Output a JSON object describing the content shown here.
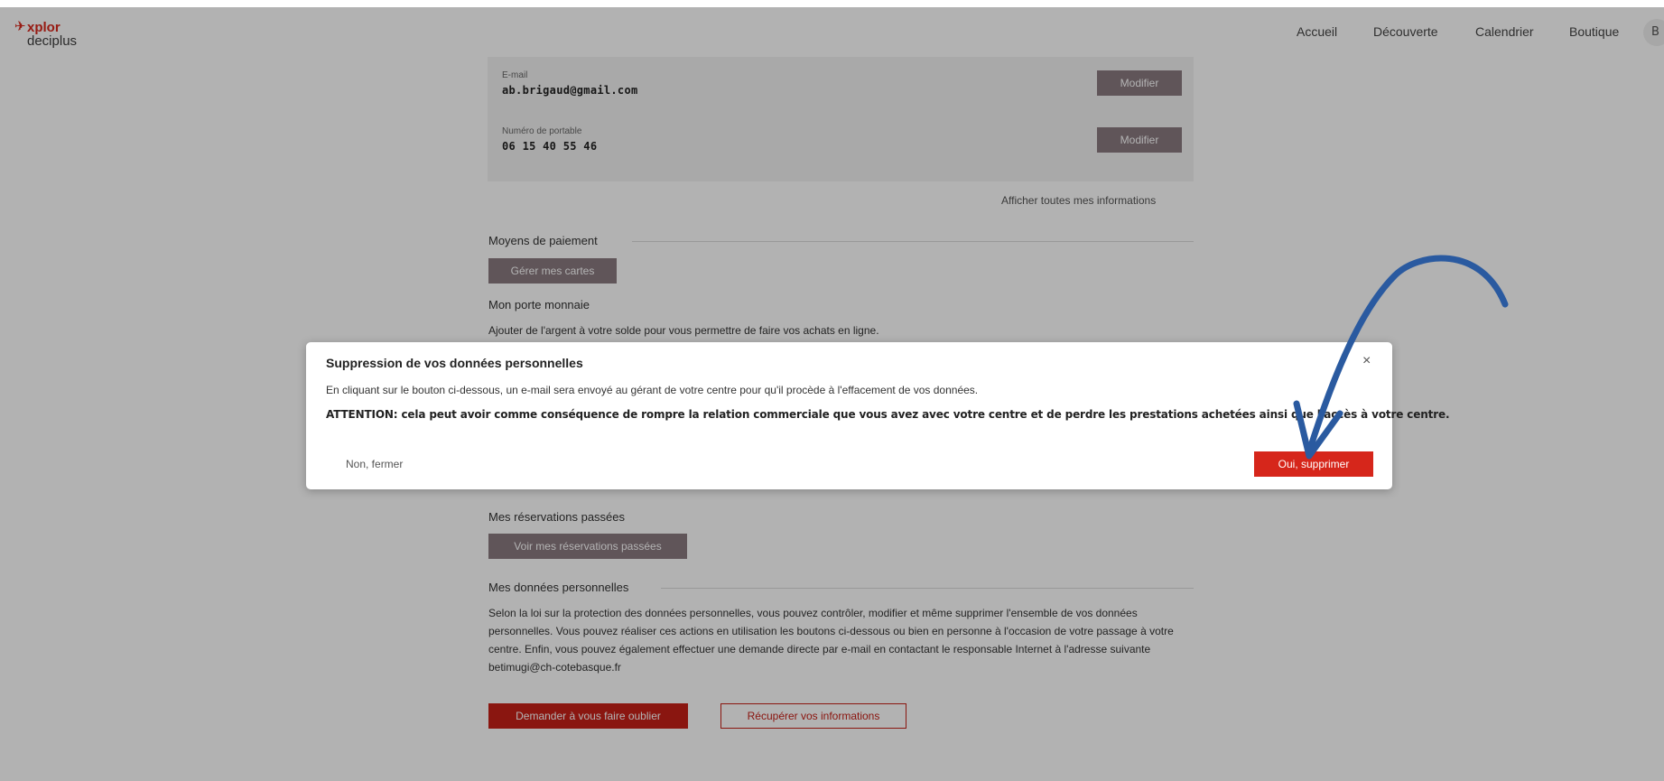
{
  "header": {
    "logo_top": "xplor",
    "logo_bottom": "deciplus",
    "nav": [
      "Accueil",
      "Découverte",
      "Calendrier",
      "Boutique"
    ],
    "avatar_letter": "B"
  },
  "profile": {
    "email_label": "E-mail",
    "email_value": "ab.brigaud@gmail.com",
    "phone_label": "Numéro de portable",
    "phone_value": "06 15 40 55 46",
    "modify_label": "Modifier",
    "show_all_link": "Afficher toutes mes informations"
  },
  "payment": {
    "title": "Moyens de paiement",
    "manage_cards": "Gérer mes cartes",
    "wallet_title": "Mon porte monnaie",
    "wallet_text": "Ajouter de l'argent à votre solde pour vous permettre de faire vos achats en ligne."
  },
  "reservations": {
    "title": "Mes réservations passées",
    "button": "Voir mes réservations passées"
  },
  "personal_data": {
    "title": "Mes données personnelles",
    "paragraph": "Selon la loi sur la protection des données personnelles, vous pouvez contrôler, modifier et même supprimer l'ensemble de vos données personnelles. Vous pouvez réaliser ces actions en utilisation les boutons ci-dessous ou bien en personne à l'occasion de votre passage à votre centre. Enfin, vous pouvez également effectuer une demande directe par e-mail en contactant le responsable Internet à l'adresse suivante betimugi@ch-cotebasque.fr",
    "forget_button": "Demander à vous faire oublier",
    "retrieve_button": "Récupérer vos informations"
  },
  "modal": {
    "title": "Suppression de vos données personnelles",
    "close_symbol": "×",
    "text": "En cliquant sur le bouton ci-dessous, un e-mail sera envoyé au gérant de votre centre pour qu'il procède à l'effacement de vos données.",
    "warning": "ATTENTION: cela peut avoir comme conséquence de rompre la relation commerciale que vous avez avec votre centre et de perdre les prestations achetées ainsi que l'accès à votre centre.",
    "cancel_label": "Non, fermer",
    "confirm_label": "Oui, supprimer"
  },
  "colors": {
    "accent_red": "#d6261b",
    "button_mauve": "#8a7a80",
    "annotation_arrow": "#2a5aa0"
  }
}
